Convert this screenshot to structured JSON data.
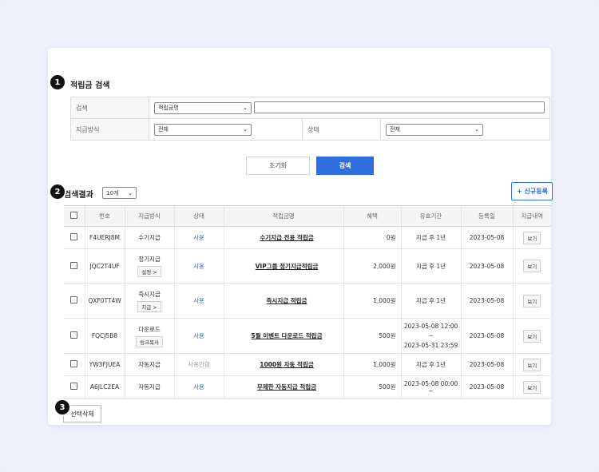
{
  "search": {
    "title": "적립금 검색",
    "row1_label": "검색",
    "field_select": "적립금명",
    "keyword_value": "",
    "row2_label": "지급방식",
    "method_select": "전체",
    "status_label": "상태",
    "status_select": "전체",
    "reset_label": "초기화",
    "search_label": "검색"
  },
  "steps": [
    "1",
    "2",
    "3"
  ],
  "results": {
    "title": "검색결과",
    "page_size": "10개",
    "new_label": "+ 신규등록",
    "delete_label": "선택삭제",
    "columns": [
      "번호",
      "지급방식",
      "상태",
      "적립금명",
      "혜택",
      "유효기간",
      "등록일",
      "지급내역"
    ],
    "rows": [
      {
        "code": "F4UERJ8M",
        "method": "수기지급",
        "method_btn": "",
        "status": "사용",
        "name": "수기지급 전용 적립금",
        "benefit": "0원",
        "validity": "지급 후 1년",
        "validity2": "",
        "date": "2023-05-08",
        "view": "보기"
      },
      {
        "code": "JQC2T4UF",
        "method": "정기지급",
        "method_btn": "설정 >",
        "status": "사용",
        "name": "VIP그룹 정기지급적립금",
        "benefit": "2,000원",
        "validity": "지급 후 1년",
        "validity2": "",
        "date": "2023-05-08",
        "view": "보기"
      },
      {
        "code": "QXF0TT4W",
        "method": "즉시지급",
        "method_btn": "지급 >",
        "status": "사용",
        "name": "즉시지급 적립금",
        "benefit": "1,000원",
        "validity": "지급 후 1년",
        "validity2": "",
        "date": "2023-05-08",
        "view": "보기"
      },
      {
        "code": "FQCJ5B8",
        "method": "다운로드",
        "method_btn": "링크복사",
        "status": "사용",
        "name": "5월 이벤트 다운로드 적립금",
        "benefit": "500원",
        "validity": "2023-05-08 12:00 ~",
        "validity2": "2023-05-31 23:59",
        "date": "2023-05-08",
        "view": "보기"
      },
      {
        "code": "YW3FJUEA",
        "method": "자동지급",
        "method_btn": "",
        "status": "사용안함",
        "name": "1000원 자동 적립금",
        "benefit": "1,000원",
        "validity": "지급 후 1년",
        "validity2": "",
        "date": "2023-05-08",
        "view": "보기"
      },
      {
        "code": "A6JLC2EA",
        "method": "자동지급",
        "method_btn": "",
        "status": "사용",
        "name": "무제한 자동지급 적립금",
        "benefit": "500원",
        "validity": "2023-05-08 00:00 ~",
        "validity2": "",
        "date": "2023-05-08",
        "view": "보기"
      }
    ]
  },
  "colors": {
    "accent": "#2f6fe0",
    "background": "#eef0fa"
  }
}
